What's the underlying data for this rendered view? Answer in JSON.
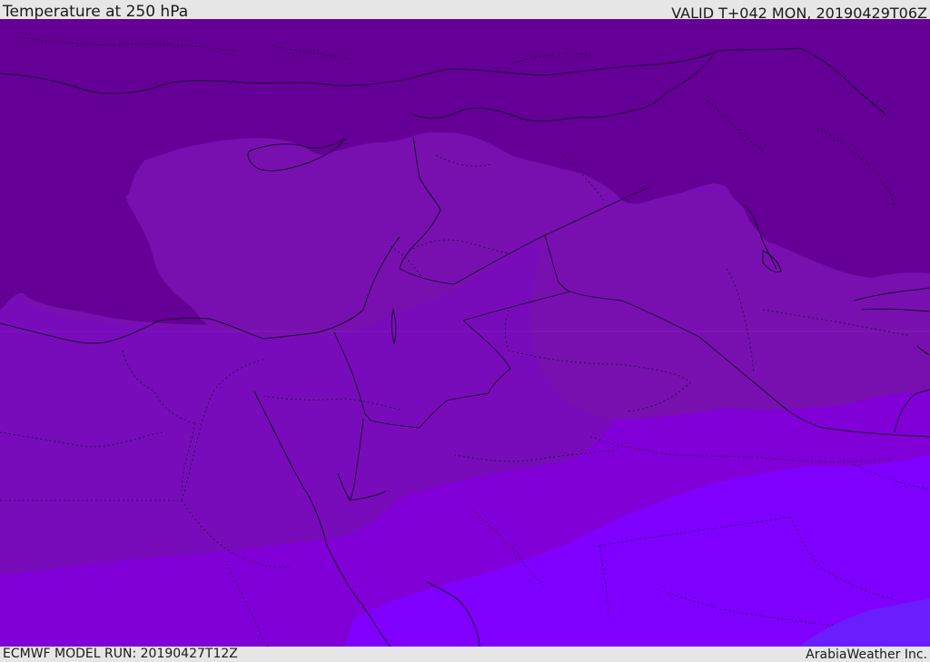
{
  "header": {
    "title": "Temperature at 250 hPa",
    "valid": "VALID T+042 MON, 20190429T06Z"
  },
  "footer": {
    "model_run": "ECMWF MODEL RUN: 20190427T12Z",
    "credit": "ArabiaWeather Inc."
  },
  "map": {
    "colors": {
      "band_coldest": "#640096",
      "band_cold": "#7810b0",
      "band_mid": "#780cbb",
      "band_warm": "#8200d8",
      "band_warmer": "#8000ff",
      "band_warmest": "#6a1eff",
      "coast_line": "#1a0a30"
    }
  }
}
